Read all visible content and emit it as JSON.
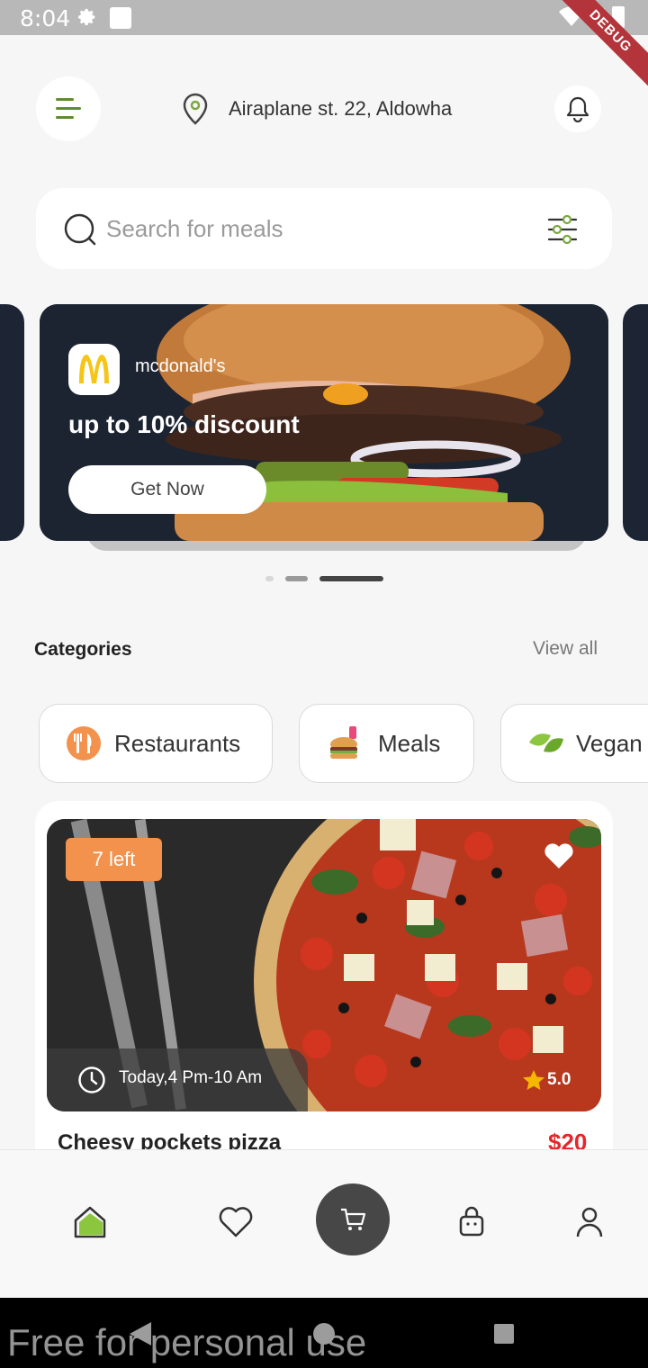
{
  "status_bar": {
    "time": "8:04",
    "debug_label": "DEBUG"
  },
  "header": {
    "address": "Airaplane st. 22, Aldowha"
  },
  "search": {
    "placeholder": "Search for meals"
  },
  "banner": {
    "brand": "mcdonald's",
    "promo_text": "up to 10% discount",
    "button_label": "Get Now",
    "active_page": 3,
    "page_count": 3
  },
  "categories": {
    "title": "Categories",
    "view_all": "View all",
    "items": [
      {
        "label": "Restaurants",
        "icon": "restaurant-icon"
      },
      {
        "label": "Meals",
        "icon": "meals-icon"
      },
      {
        "label": "Vegan",
        "icon": "leaf-icon"
      }
    ]
  },
  "food_card": {
    "badge": "7 left",
    "time": "Today,4 Pm-10 Am",
    "rating": "5.0",
    "name": "Cheesy pockets pizza",
    "price": "$20"
  },
  "bottom_nav": {
    "items": [
      "home-icon",
      "heart-icon",
      "cart-icon",
      "bag-icon",
      "profile-icon"
    ],
    "active": "home-icon"
  },
  "watermark": "Free for personal use",
  "colors": {
    "accent_green": "#5e8c2e",
    "price_red": "#e6262a",
    "badge_orange": "#f2924c"
  }
}
